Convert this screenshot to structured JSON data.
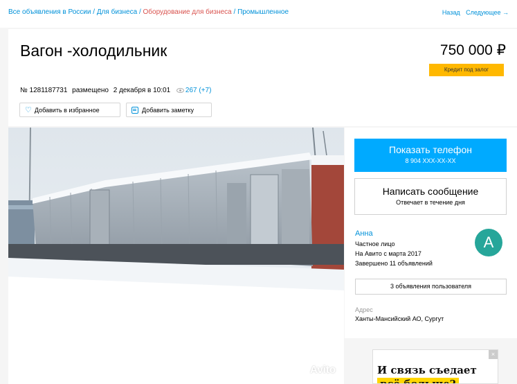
{
  "breadcrumb": {
    "items": [
      {
        "label": "Все объявления в России",
        "color": "#0091d9"
      },
      {
        "label": "Для бизнеса",
        "color": "#0091d9"
      },
      {
        "label": "Оборудование для бизнеса",
        "color": "#d9534f"
      },
      {
        "label": "Промышленное",
        "color": "#0091d9"
      }
    ],
    "separator": " / "
  },
  "nav": {
    "back": "Назад",
    "next": "Следующее →"
  },
  "listing": {
    "title": "Вагон -холодильник",
    "price": "750 000 ₽",
    "credit_badge": "Кредит под залог",
    "number": "№ 1281187731",
    "posted_word": "размещено",
    "posted_date": "2 декабря в 10:01",
    "views": "267 (+7)"
  },
  "actions": {
    "favorite_label": "Добавить в избранное",
    "note_label": "Добавить заметку"
  },
  "photo": {
    "watermark": "Avito"
  },
  "contact": {
    "phone_button": "Показать телефон",
    "phone_masked": "8 904 XXX-XX-XX",
    "message_button": "Написать сообщение",
    "message_sub": "Отвечает в течение дня"
  },
  "seller": {
    "name": "Анна",
    "type": "Частное лицо",
    "since": "На Авито с марта 2017",
    "completed": "Завершено 11 объявлений",
    "avatar_letter": "A",
    "other_ads_button": "3 объявления пользователя"
  },
  "address": {
    "label": "Адрес",
    "value": "Ханты-Мансийский АО, Сургут"
  },
  "ad": {
    "line1": "И связь съедает",
    "line2": "всё больше?",
    "close": "×"
  },
  "colors": {
    "accent": "#0091d9",
    "phone_button": "#00aaff",
    "credit_badge": "#ffb800",
    "avatar": "#26a69a",
    "breadcrumb_active": "#d9534f"
  }
}
